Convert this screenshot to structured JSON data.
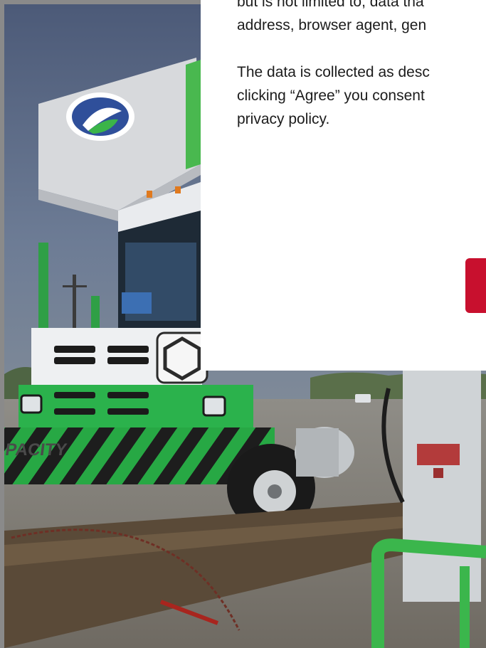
{
  "consent_modal": {
    "text_line_1": "but is not limited to, data tha",
    "text_line_2": "address, browser agent, gen",
    "text_line_3": "The data is collected as desc",
    "text_line_4": "clicking “Agree” you consent",
    "text_line_5": "privacy policy.",
    "agree_button_label": ""
  },
  "background_photo": {
    "truck_side_lettering": "CAPACITY"
  },
  "colors": {
    "accent_red": "#c8102e",
    "truck_green": "#2bb24c",
    "modal_bg": "#ffffff",
    "backdrop_gray": "#8a8a8a"
  }
}
